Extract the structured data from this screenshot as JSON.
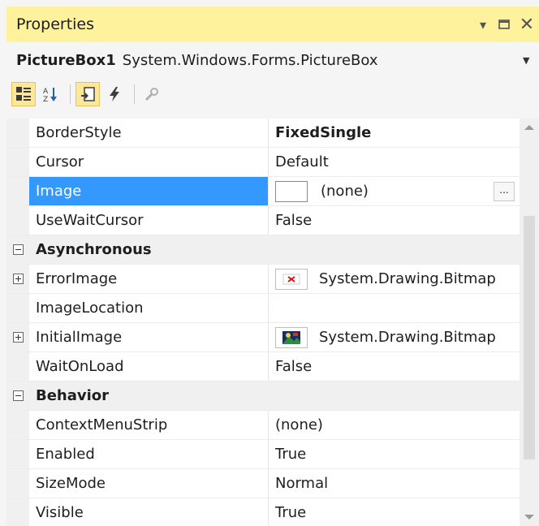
{
  "window": {
    "title": "Properties"
  },
  "object": {
    "name": "PictureBox1",
    "type": "System.Windows.Forms.PictureBox"
  },
  "properties": {
    "borderstyle": {
      "name": "BorderStyle",
      "value": "FixedSingle"
    },
    "cursor": {
      "name": "Cursor",
      "value": "Default"
    },
    "image": {
      "name": "Image",
      "value": "(none)"
    },
    "usewaitcursor": {
      "name": "UseWaitCursor",
      "value": "False"
    },
    "cat_async": "Asynchronous",
    "errorimage": {
      "name": "ErrorImage",
      "value": "System.Drawing.Bitmap"
    },
    "imagelocation": {
      "name": "ImageLocation",
      "value": ""
    },
    "initialimage": {
      "name": "InitialImage",
      "value": "System.Drawing.Bitmap"
    },
    "waitonload": {
      "name": "WaitOnLoad",
      "value": "False"
    },
    "cat_behavior": "Behavior",
    "contextmenustrip": {
      "name": "ContextMenuStrip",
      "value": "(none)"
    },
    "enabled": {
      "name": "Enabled",
      "value": "True"
    },
    "sizemode": {
      "name": "SizeMode",
      "value": "Normal"
    },
    "visible": {
      "name": "Visible",
      "value": "True"
    }
  },
  "ellipsis_label": "...",
  "icons": [
    "categorized-icon",
    "alphabetical-icon",
    "properties-icon",
    "events-icon",
    "property-pages-icon",
    "dropdown-arrow-icon",
    "minimize-icon",
    "maximize-icon",
    "close-icon"
  ],
  "colors": {
    "title_bg": "#fff29d",
    "selection": "#3399ff",
    "active_tool": "#fde89a"
  }
}
